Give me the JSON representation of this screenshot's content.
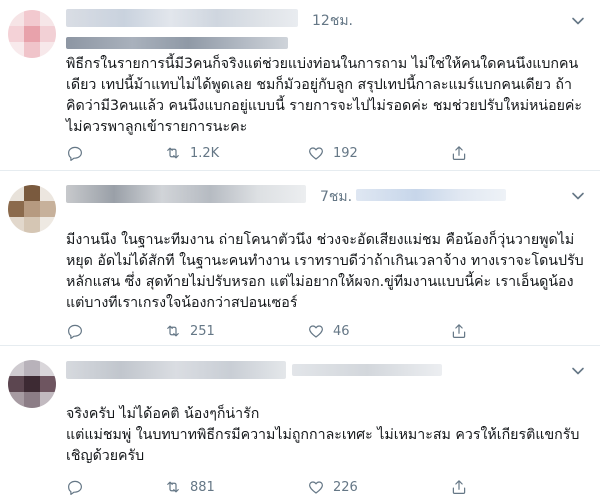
{
  "colors": {
    "text": "#14171a",
    "muted": "#657786",
    "icon": "#657786",
    "divider": "#e6ecf0"
  },
  "tweets": [
    {
      "time": "12ชม.",
      "text": "พิธีกรในรายการนี้มี3คนก็จริงแต่ช่วยแบ่งท่อนในการถาม ไม่ใช่ให้คนใดคนนึงแบกคน\nเดียว เทปนี้ม้าแทบไม่ได้พูดเลย ชมก็มัวอยู่กับลูก สรุปเทปนี้กาละแมร์แบกคนเดียว ถ้า\nคิดว่ามี3คนแล้ว คนนึงแบกอยู่แบบนี้ รายการจะไปไม่รอดค่ะ ชมช่วยปรับใหม่หน่อยค่ะ\nไม่ควรพาลูกเข้ารายการนะคะ",
      "retweets": "1.2K",
      "likes": "192"
    },
    {
      "time": "7ชม.",
      "text": "มีงานนึง ในฐานะทีมงาน ถ่ายโคนาตัวนึง ช่วงจะอัดเสียงแม่ชม คือน้องก็วุ่นวายพูดไม่\nหยุด อัดไม่ได้สักที ในฐานะคนทำงาน เราทราบดีว่าถ้าเกินเวลาจ้าง ทางเราจะโดนปรับ\nหลักแสน ซึ่ง สุดท้ายไม่ปรับหรอก แต่ไม่อยากให้ผจก.ขู่ทีมงานแบบนี้ค่ะ เราเอ็นดูน้อง\nแต่บางทีเราเกรงใจน้องกว่าสปอนเซอร์",
      "retweets": "251",
      "likes": "46"
    },
    {
      "time": "",
      "text": "จริงครับ ไม่ได้อคติ น้องๆก็น่ารัก\nแต่แม่ชมพู่ ในบทบาทพิธีกรมีความไม่ถูกกาละเทศะ ไม่เหมาะสม ควรให้เกียรติแขกรับ\nเชิญด้วยครับ",
      "retweets": "881",
      "likes": "226"
    }
  ]
}
